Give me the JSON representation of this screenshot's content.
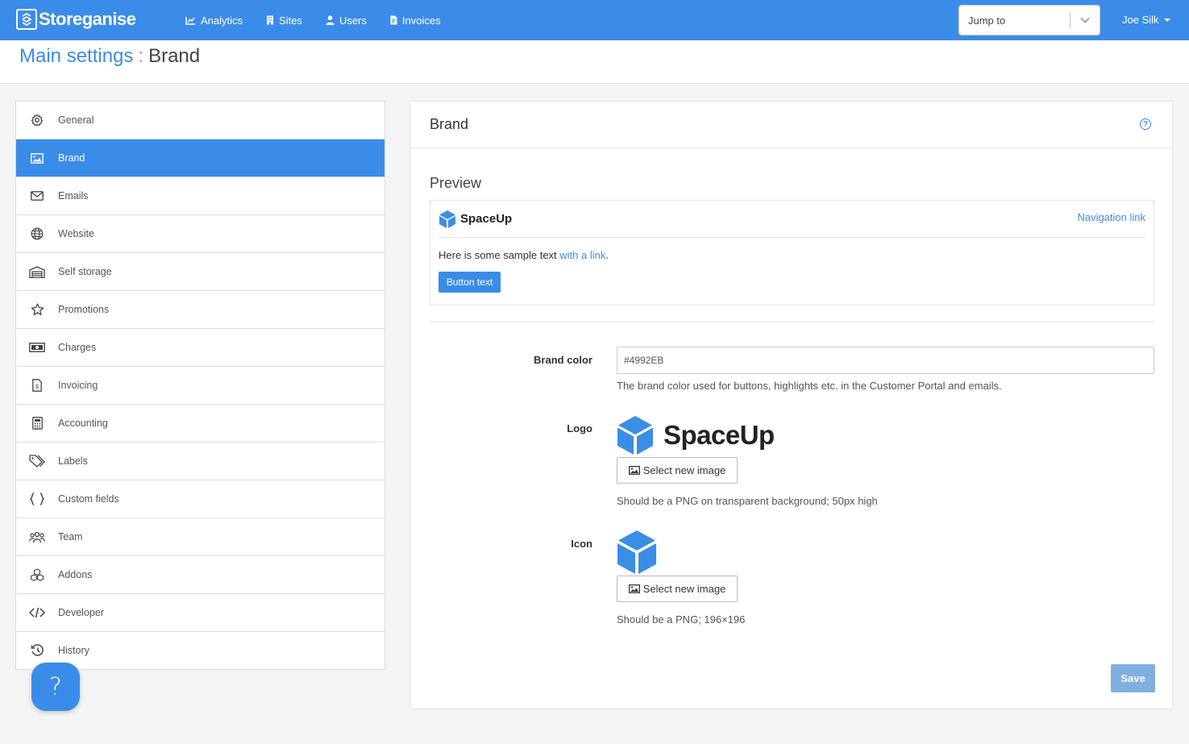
{
  "app": {
    "brand_name": "Storeganise"
  },
  "nav": [
    {
      "label": "Analytics",
      "icon": "chart-icon"
    },
    {
      "label": "Sites",
      "icon": "building-icon"
    },
    {
      "label": "Users",
      "icon": "user-icon"
    },
    {
      "label": "Invoices",
      "icon": "invoice-icon"
    }
  ],
  "jump": {
    "placeholder": "Jump to"
  },
  "user": {
    "name": "Joe Silk"
  },
  "breadcrumb": {
    "parent": "Main settings",
    "separator": ":",
    "current": "Brand"
  },
  "sidebar": {
    "active": "Brand",
    "items": [
      {
        "label": "General",
        "icon": "gear-icon"
      },
      {
        "label": "Brand",
        "icon": "image-icon"
      },
      {
        "label": "Emails",
        "icon": "envelope-icon"
      },
      {
        "label": "Website",
        "icon": "globe-icon"
      },
      {
        "label": "Self storage",
        "icon": "garage-icon"
      },
      {
        "label": "Promotions",
        "icon": "star-icon"
      },
      {
        "label": "Charges",
        "icon": "money-icon"
      },
      {
        "label": "Invoicing",
        "icon": "invoice-icon"
      },
      {
        "label": "Accounting",
        "icon": "calculator-icon"
      },
      {
        "label": "Labels",
        "icon": "tags-icon"
      },
      {
        "label": "Custom fields",
        "icon": "braces-icon"
      },
      {
        "label": "Team",
        "icon": "team-icon"
      },
      {
        "label": "Addons",
        "icon": "cubes-icon"
      },
      {
        "label": "Developer",
        "icon": "code-icon"
      },
      {
        "label": "History",
        "icon": "history-icon"
      }
    ]
  },
  "card": {
    "title": "Brand",
    "preview": {
      "title": "Preview",
      "logo_name": "SpaceUp",
      "nav_link": "Navigation link",
      "sample_text": "Here is some sample text ",
      "sample_link": "with a link",
      "sample_end": ".",
      "button_text": "Button text"
    },
    "brand_color": {
      "label": "Brand color",
      "value": "#4992EB",
      "help": "The brand color used for buttons, highlights etc. in the Customer Portal and emails."
    },
    "logo": {
      "label": "Logo",
      "name": "SpaceUp",
      "button": "Select new image",
      "help": "Should be a PNG on transparent background; 50px high"
    },
    "icon": {
      "label": "Icon",
      "button": "Select new image",
      "help": "Should be a PNG; 196×196"
    },
    "save_label": "Save"
  },
  "float_help": {
    "glyph": "?"
  },
  "colors": {
    "accent": "#3b8ce8",
    "save_disabled": "#7fb0e0",
    "cube": "#3a8ee6"
  }
}
